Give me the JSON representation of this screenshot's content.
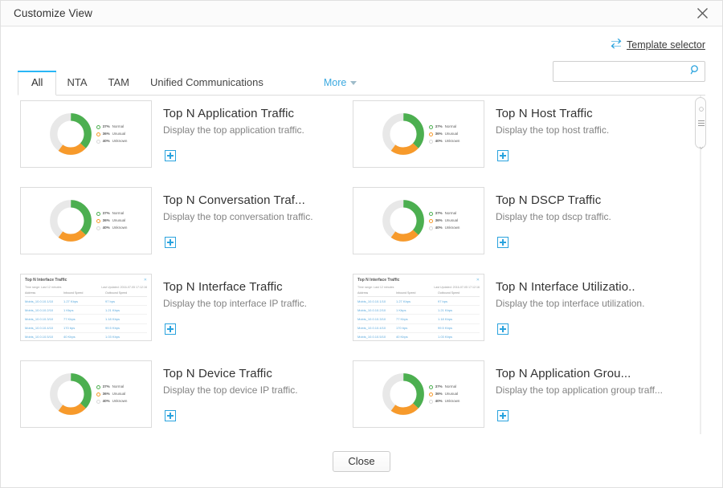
{
  "window": {
    "title": "Customize View",
    "close_icon": "close-icon"
  },
  "toolbar": {
    "template_selector_label": "Template selector",
    "template_selector_icon": "swap-arrows-icon",
    "search_value": "",
    "search_placeholder": "",
    "search_icon": "search-icon"
  },
  "tabs": [
    {
      "label": "All",
      "active": true
    },
    {
      "label": "NTA",
      "active": false
    },
    {
      "label": "TAM",
      "active": false
    },
    {
      "label": "Unified Communications",
      "active": false
    }
  ],
  "more_tab": {
    "label": "More",
    "icon": "chevron-down-icon"
  },
  "donut_legend": [
    {
      "pct": "37%",
      "label": "Normal",
      "color": "#4caf50"
    },
    {
      "pct": "36%",
      "label": "Unusual",
      "color": "#f79a2b"
    },
    {
      "pct": "40%",
      "label": "Unknown",
      "color": "#e3e3e3"
    }
  ],
  "table_thumb": {
    "title": "Top N Interface Traffic",
    "close_icon": "close-icon",
    "subtitle": "Time range: Last 12 minutes",
    "updated": "Last Updated: 2016-07-05 17:12:16",
    "columns": [
      "Address",
      "Inbound Speed",
      "Outbound Speed"
    ],
    "rows": [
      {
        "address": "Mobis_10.0.10.1/10",
        "inbound": "1.27 Kbps",
        "outbound": "97 bps"
      },
      {
        "address": "Mobis_10.0.10.2/10",
        "inbound": "1 Kbps",
        "outbound": "1.21 Kbps"
      },
      {
        "address": "Mobis_10.0.10.3/10",
        "inbound": "77 Kbps",
        "outbound": "1.18 Kbps"
      },
      {
        "address": "Mobis_10.0.10.4/10",
        "inbound": "170 bps",
        "outbound": "99.5 Kbps"
      },
      {
        "address": "Mobis_10.0.10.5/10",
        "inbound": "40 Kbps",
        "outbound": "1.03 Kbps"
      }
    ]
  },
  "cards": [
    {
      "title": "Top N Application Traffic",
      "desc": "Display the top application traffic.",
      "thumb": "donut",
      "add_label": "add-widget"
    },
    {
      "title": "Top N Host Traffic",
      "desc": "Display the top host traffic.",
      "thumb": "donut",
      "add_label": "add-widget"
    },
    {
      "title": "Top N Conversation Traf...",
      "desc": "Display the top conversation traffic.",
      "thumb": "donut",
      "add_label": "add-widget"
    },
    {
      "title": "Top N DSCP Traffic",
      "desc": "Display the top dscp traffic.",
      "thumb": "donut",
      "add_label": "add-widget"
    },
    {
      "title": "Top N Interface Traffic",
      "desc": "Display the top interface IP traffic.",
      "thumb": "table",
      "add_label": "add-widget"
    },
    {
      "title": "Top N Interface Utilizatio..",
      "desc": "Display the top interface utilization.",
      "thumb": "table",
      "add_label": "add-widget"
    },
    {
      "title": "Top N Device Traffic",
      "desc": "Display the top device IP traffic.",
      "thumb": "donut",
      "add_label": "add-widget"
    },
    {
      "title": "Top N Application Grou...",
      "desc": "Display the top application group traff...",
      "thumb": "donut",
      "add_label": "add-widget"
    }
  ],
  "footer": {
    "close_label": "Close"
  },
  "colors": {
    "accent": "#29b6f6",
    "green": "#4caf50",
    "orange": "#f79a2b",
    "gray": "#e3e3e3"
  }
}
